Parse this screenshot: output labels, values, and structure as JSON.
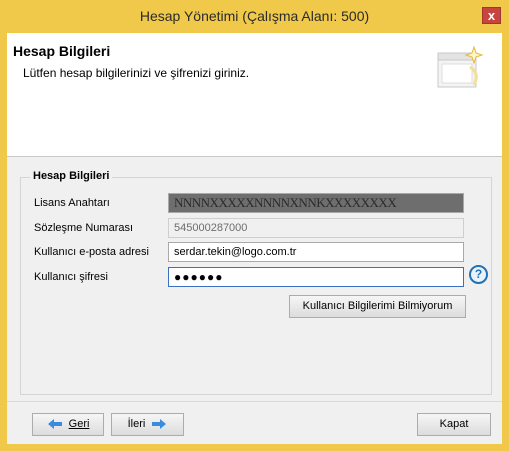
{
  "window": {
    "title": "Hesap Yönetimi (Çalışma Alanı: 500)",
    "close_label": "x"
  },
  "banner": {
    "title": "Hesap Bilgileri",
    "subtitle": "Lütfen hesap bilgilerinizi ve şifrenizi giriniz."
  },
  "group": {
    "legend": "Hesap Bilgileri",
    "fields": {
      "license": {
        "label": "Lisans Anahtarı",
        "value": "NNNNXXXXXNNNNXNNKXXXXXXXX"
      },
      "contract": {
        "label": "Sözleşme Numarası",
        "value": "545000287000"
      },
      "email": {
        "label": "Kullanıcı e-posta adresi",
        "value": "serdar.tekin@logo.com.tr"
      },
      "password": {
        "label": "Kullanıcı şifresi",
        "value": "●●●●●●"
      }
    },
    "forgot_button": "Kullanıcı Bilgilerimi Bilmiyorum",
    "help_icon": "question-mark-icon"
  },
  "footer": {
    "back_button": "Geri",
    "next_button": "İleri",
    "close_button": "Kapat"
  },
  "colors": {
    "titlebar": "#f0c84a",
    "accent_arrow": "#3a8be0",
    "close_button": "#c7443f"
  }
}
